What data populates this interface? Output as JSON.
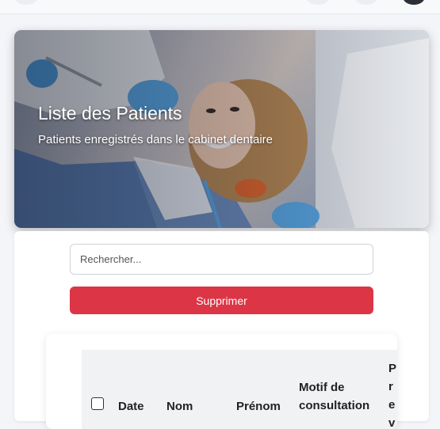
{
  "hero": {
    "title": "Liste des Patients",
    "subtitle": "Patients enregistrés dans le cabinet dentaire"
  },
  "search": {
    "placeholder": "Rechercher..."
  },
  "actions": {
    "delete_label": "Supprimer"
  },
  "table": {
    "columns": [
      "Date",
      "Nom",
      "Prénom",
      "Motif de consultation",
      "P re vo"
    ]
  },
  "colors": {
    "danger": "#dc3545",
    "header_bg": "#f1f2f4"
  }
}
